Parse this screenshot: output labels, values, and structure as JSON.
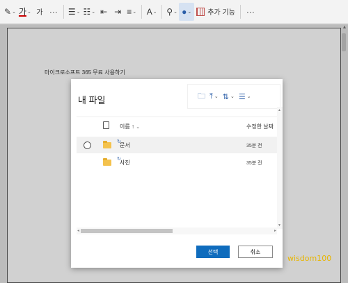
{
  "ribbon": {
    "highlight_icon": "highlighter-icon",
    "font_color_glyph": "가",
    "clear_format_glyph": "가",
    "more": "···",
    "addin_label": "추가 기능",
    "more2": "···"
  },
  "doc": {
    "body_text": "마이크로소프트 365 무료 사용하기"
  },
  "dialog": {
    "title": "내 파일",
    "columns": {
      "name": "이름 ↑",
      "modified": "수정한 날짜"
    },
    "rows": [
      {
        "name": "문서",
        "modified": "35분 전",
        "selected": true
      },
      {
        "name": "사진",
        "modified": "35분 전",
        "selected": false
      }
    ],
    "ok_label": "선택",
    "cancel_label": "취소"
  },
  "watermark": "wisdom100",
  "colors": {
    "accent": "#0f6cbd",
    "folder": "#f4c24d",
    "watermark": "#e8b500"
  }
}
